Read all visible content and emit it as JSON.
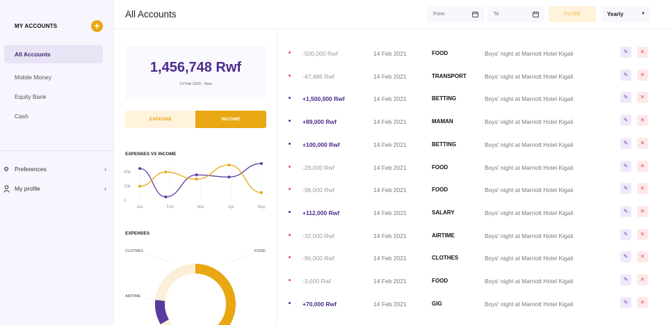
{
  "sidebar": {
    "title": "MY ACCOUNTS",
    "add_label": "+",
    "accounts": [
      {
        "label": "All Accounts"
      },
      {
        "label": "Mobile Money"
      },
      {
        "label": "Equity Bank"
      },
      {
        "label": "Cash"
      }
    ],
    "links": [
      {
        "label": "Preferences",
        "icon": "gear-icon"
      },
      {
        "label": "My profile",
        "icon": "user-icon"
      }
    ]
  },
  "header": {
    "title": "All Accounts",
    "from_label": "From",
    "to_label": "To",
    "filter_label": "FILTER",
    "period": "Yearly"
  },
  "summary": {
    "balance": "1,456,748 Rwf",
    "period": "14 Feb 2020 - Now",
    "toggle": {
      "expense": "EXPENSE",
      "income": "INCOME",
      "selected": "INCOME"
    }
  },
  "chart_data": [
    {
      "type": "line",
      "title": "EXPENSES VS INCOME",
      "categories": [
        "Jan",
        "Feb",
        "Mar",
        "Apr",
        "May"
      ],
      "y_ticks": [
        "40k",
        "20k",
        "0"
      ],
      "ylim": [
        0,
        50000
      ],
      "x": [
        0,
        1,
        2,
        3,
        4
      ],
      "series": [
        {
          "color": "#5b3a9e",
          "x": [
            0,
            0.8,
            1.75,
            2.75,
            3.75
          ],
          "values": [
            45000,
            5000,
            36000,
            33000,
            52000
          ]
        },
        {
          "color": "#e8a713",
          "x": [
            0,
            0.8,
            1.75,
            2.75,
            3.75
          ],
          "values": [
            20000,
            40000,
            30000,
            50000,
            11000
          ]
        }
      ]
    },
    {
      "type": "pie",
      "title": "EXPENSES",
      "labels": [
        "FOOD",
        "AIRTIME",
        "CLOTHES"
      ],
      "values": [
        50,
        10,
        40
      ],
      "colors": [
        "#e8a713",
        "#5b3a9e",
        "#fbefd7"
      ]
    }
  ],
  "transactions": [
    {
      "amount": "-500,000 Rwf",
      "type": "neg",
      "date": "14 Feb 2021",
      "category": "FOOD",
      "description": "Boys' night at Marriott Hotel Kigali"
    },
    {
      "amount": "-47,486 Rwf",
      "type": "neg",
      "date": "14 Feb 2021",
      "category": "TRANSPORT",
      "description": "Boys' night at Marriott Hotel Kigali"
    },
    {
      "amount": "+1,500,000 Rwf",
      "type": "pos",
      "date": "14 Feb 2021",
      "category": "BETTING",
      "description": "Boys' night at Marriott Hotel Kigali"
    },
    {
      "amount": "+89,000 Rwf",
      "type": "pos",
      "date": "14 Feb 2021",
      "category": "MAMAN",
      "description": "Boys' night at Marriott Hotel Kigali"
    },
    {
      "amount": "+100,000 Rwf",
      "type": "pos",
      "date": "14 Feb 2021",
      "category": "BETTING",
      "description": "Boys' night at Marriott Hotel Kigali"
    },
    {
      "amount": "-28,000 Rwf",
      "type": "neg",
      "date": "14 Feb 2021",
      "category": "FOOD",
      "description": "Boys' night at Marriott Hotel Kigali"
    },
    {
      "amount": "-98,000 Rwf",
      "type": "neg",
      "date": "14 Feb 2021",
      "category": "FOOD",
      "description": "Boys' night at Marriott Hotel Kigali"
    },
    {
      "amount": "+112,000 Rwf",
      "type": "pos",
      "date": "14 Feb 2021",
      "category": "SALARY",
      "description": "Boys' night at Marriott Hotel Kigali"
    },
    {
      "amount": "-32,000 Rwf",
      "type": "neg",
      "date": "14 Feb 2021",
      "category": "AIRTIME",
      "description": "Boys' night at Marriott Hotel Kigali"
    },
    {
      "amount": "-96,000 Rwf",
      "type": "neg",
      "date": "14 Feb 2021",
      "category": "CLOTHES",
      "description": "Boys' night at Marriott Hotel Kigali"
    },
    {
      "amount": "-3,000 Rwf",
      "type": "neg",
      "date": "14 Feb 2021",
      "category": "FOOD",
      "description": "Boys' night at Marriott Hotel Kigali"
    },
    {
      "amount": "+70,000 Rwf",
      "type": "pos",
      "date": "14 Feb 2021",
      "category": "GIG",
      "description": "Boys' night at Marriott Hotel Kigali"
    }
  ],
  "colors": {
    "accent": "#e8a713",
    "brand": "#4b2a8c",
    "negative_dot": "#e04f5f",
    "positive_dot": "#4b2a8c"
  }
}
